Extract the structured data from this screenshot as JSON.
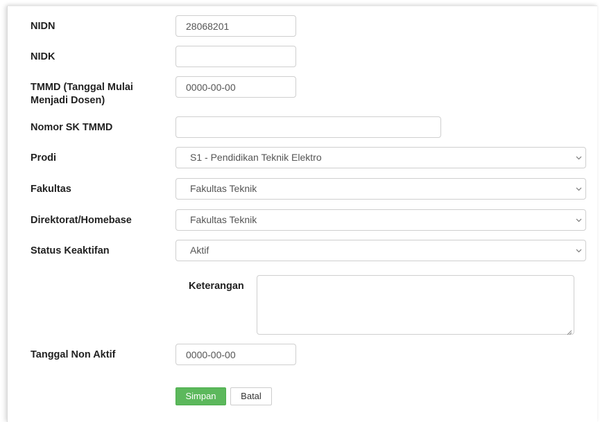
{
  "form": {
    "nidn": {
      "label": "NIDN",
      "value": "28068201"
    },
    "nidk": {
      "label": "NIDK",
      "value": ""
    },
    "tmmd": {
      "label_line1": "TMMD (Tanggal Mulai",
      "label_line2": "Menjadi Dosen)",
      "value": "0000-00-00"
    },
    "nomor_sk": {
      "label": "Nomor SK TMMD",
      "value": ""
    },
    "prodi": {
      "label": "Prodi",
      "value": "S1 - Pendidikan Teknik Elektro"
    },
    "fakultas": {
      "label": "Fakultas",
      "value": "Fakultas Teknik"
    },
    "direktorat": {
      "label": "Direktorat/Homebase",
      "value": "Fakultas Teknik"
    },
    "status": {
      "label": "Status Keaktifan",
      "value": "Aktif"
    },
    "keterangan": {
      "label": "Keterangan",
      "value": ""
    },
    "tanggal_non_aktif": {
      "label": "Tanggal Non Aktif",
      "value": "0000-00-00"
    }
  },
  "buttons": {
    "save_label": "Simpan",
    "cancel_label": "Batal"
  },
  "colors": {
    "save_button": "#5cb85c",
    "label_text": "#222222",
    "input_border": "#cfcfcf"
  },
  "icons": {
    "select_arrow": "chevron-down-icon",
    "textarea_resize": "resize-handle-icon"
  }
}
